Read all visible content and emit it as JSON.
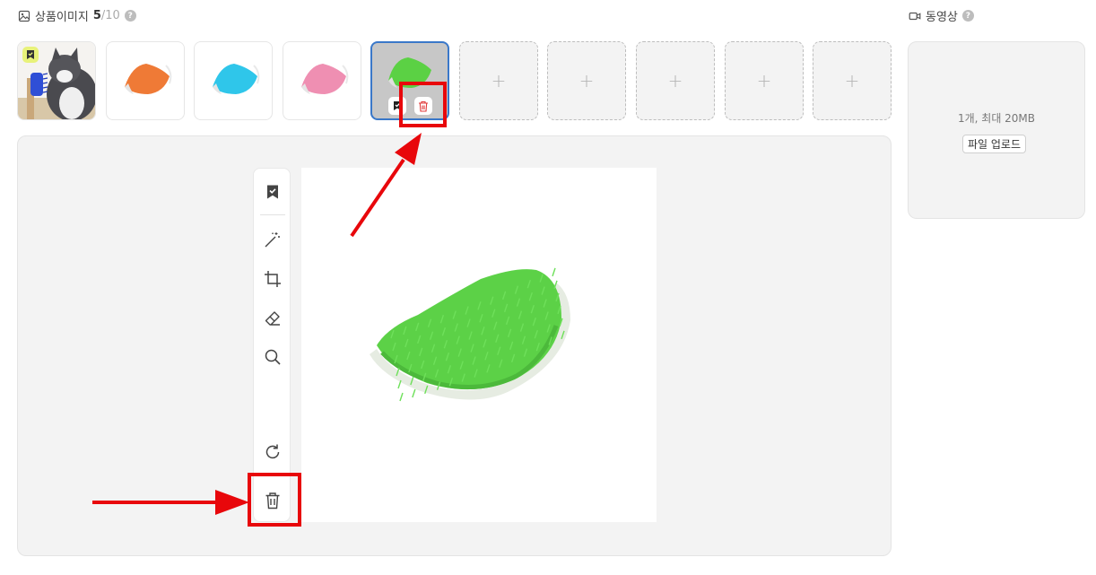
{
  "images_section": {
    "title": "상품이미지",
    "count": "5",
    "total": "/10",
    "help": "?"
  },
  "video_section": {
    "title": "동영상",
    "help": "?",
    "limit_text": "1개, 최대 20MB",
    "upload_label": "파일 업로드"
  },
  "thumbnails": [
    {
      "kind": "cat-photo",
      "representative": true
    },
    {
      "kind": "product",
      "color": "#ef7a36"
    },
    {
      "kind": "product",
      "color": "#2fc6ea"
    },
    {
      "kind": "product",
      "color": "#ef8fb2"
    },
    {
      "kind": "product",
      "color": "#5bd144",
      "selected": true
    }
  ],
  "empty_slot_label": "+",
  "empty_slots": 5,
  "editor": {
    "tools": [
      "set-representative-icon",
      "magic-wand-icon",
      "crop-icon",
      "eraser-icon",
      "zoom-icon",
      "rotate-icon",
      "trash-icon"
    ]
  },
  "colors": {
    "accent": "#3a78c9",
    "annotation": "#e8070b",
    "product_green": "#5bd144"
  }
}
